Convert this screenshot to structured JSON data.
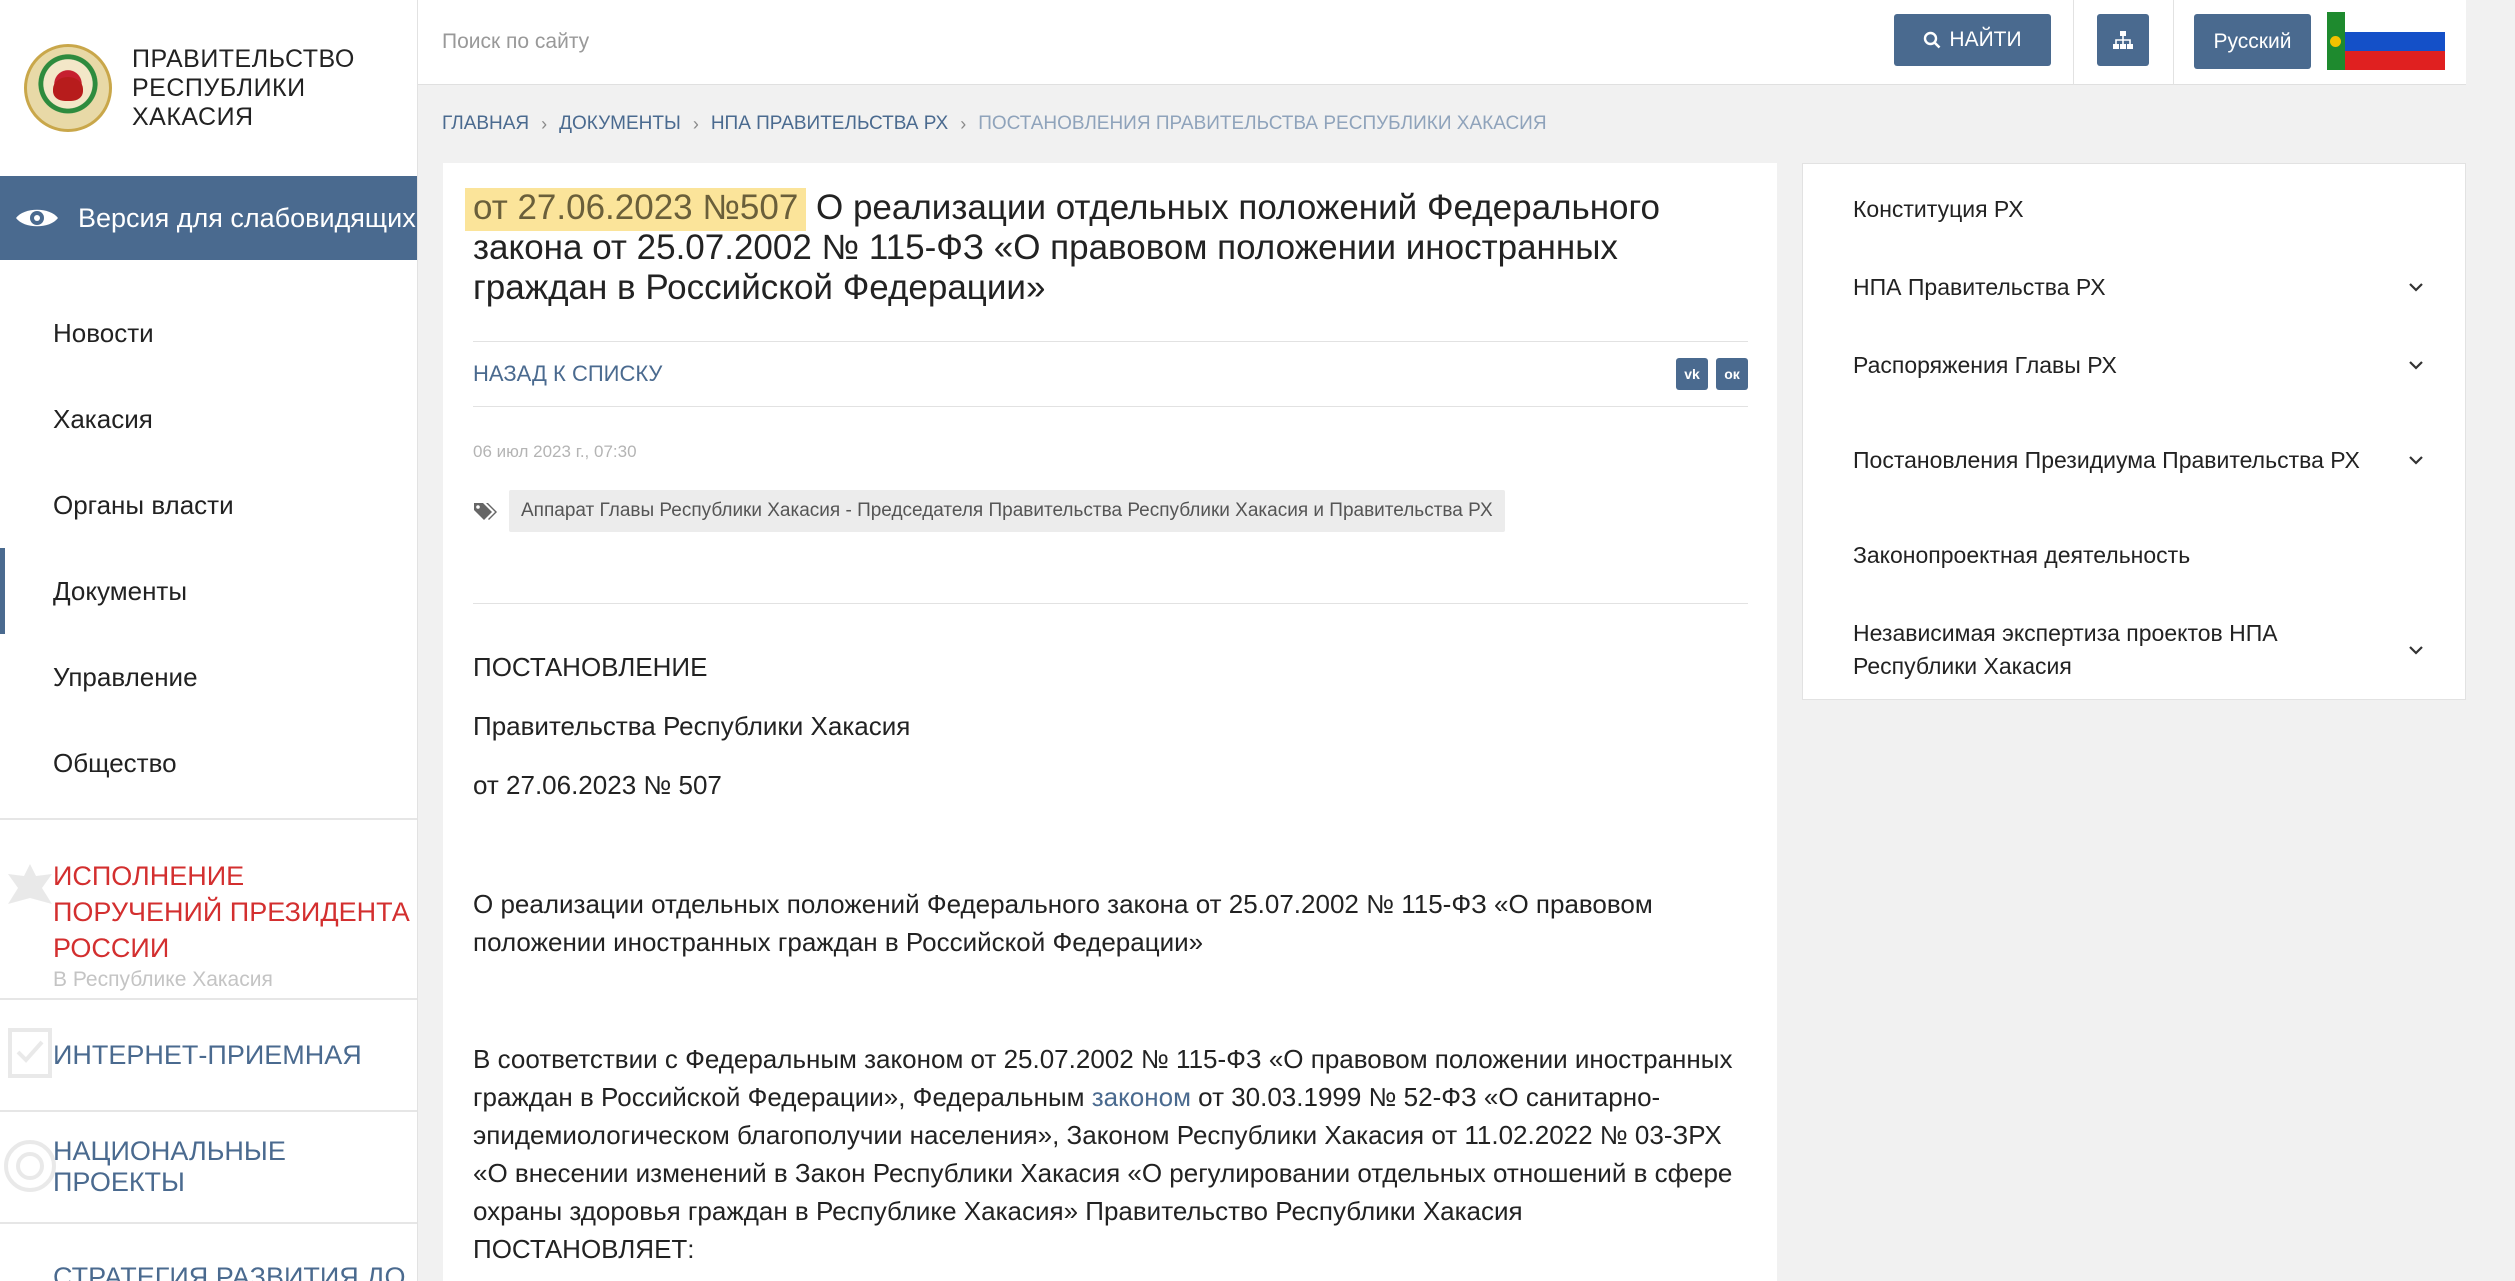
{
  "header": {
    "search_placeholder": "Поиск по сайту",
    "search_button": "НАЙТИ",
    "language": "Русский",
    "accent_color": "#4a6a8f"
  },
  "sidebar": {
    "logo_text": "ПРАВИТЕЛЬСТВО РЕСПУБЛИКИ ХАКАСИЯ",
    "low_vision": "Версия для слабовидящих",
    "nav": [
      {
        "label": "Новости",
        "active": false
      },
      {
        "label": "Хакасия",
        "active": false
      },
      {
        "label": "Органы власти",
        "active": false
      },
      {
        "label": "Документы",
        "active": true
      },
      {
        "label": "Управление",
        "active": false
      },
      {
        "label": "Общество",
        "active": false
      }
    ],
    "promos": {
      "president_title": "ИСПОЛНЕНИЕ ПОРУЧЕНИЙ ПРЕЗИДЕНТА РОССИИ",
      "president_sub": "В Республике Хакасия",
      "reception": "ИНТЕРНЕТ-ПРИЕМНАЯ",
      "national": "НАЦИОНАЛЬНЫЕ ПРОЕКТЫ",
      "strategy": "СТРАТЕГИЯ РАЗВИТИЯ ДО"
    }
  },
  "breadcrumb": [
    "ГЛАВНАЯ",
    "ДОКУМЕНТЫ",
    "НПА ПРАВИТЕЛЬСТВА РХ",
    "ПОСТАНОВЛЕНИЯ ПРАВИТЕЛЬСТВА РЕСПУБЛИКИ ХАКАСИЯ"
  ],
  "article": {
    "title_highlight": "от 27.06.2023 №507",
    "title_rest": " О реализации отдельных положений Федерального закона от 25.07.2002 № 115-ФЗ «О правовом положении иностранных граждан в Российской Федерации»",
    "back_link": "НАЗАД К СПИСКУ",
    "share_vk": "vk",
    "share_ok": "ок",
    "date": "06 июл 2023 г., 07:30",
    "tag": "Аппарат Главы Республики Хакасия - Председателя Правительства Республики Хакасия и Правительства РХ",
    "body": {
      "p1": "ПОСТАНОВЛЕНИЕ",
      "p2": "Правительства Республики Хакасия",
      "p3": "от 27.06.2023 № 507",
      "p4": "О реализации отдельных положений Федерального закона от 25.07.2002 № 115-ФЗ «О правовом положении иностранных граждан в Российской Федерации»",
      "p5_before": "В соответствии с Федеральным законом от 25.07.2002 № 115-ФЗ «О правовом положении иностранных граждан в Российской Федерации», Федеральным ",
      "p5_link": "законом",
      "p5_after": " от 30.03.1999 № 52-ФЗ «О санитарно-эпидемиологическом благополучии населения», Законом Республики Хакасия от 11.02.2022 № 03-ЗРХ «О внесении изменений в Закон Республики Хакасия «О регулировании отдельных отношений в сфере охраны здоровья граждан в Республике Хакасия» Правительство Республики Хакасия ПОСТАНОВЛЯЕТ:"
    }
  },
  "right_menu": [
    {
      "label": "Конституция РХ",
      "expandable": false
    },
    {
      "label": "НПА Правительства РХ",
      "expandable": true
    },
    {
      "label": "Распоряжения Главы РХ",
      "expandable": true
    },
    {
      "label": "Постановления Президиума Правительства РХ",
      "expandable": true
    },
    {
      "label": "Законопроектная деятельность",
      "expandable": false
    },
    {
      "label": "Независимая экспертиза проектов НПА Республики Хакасия",
      "expandable": true
    }
  ]
}
